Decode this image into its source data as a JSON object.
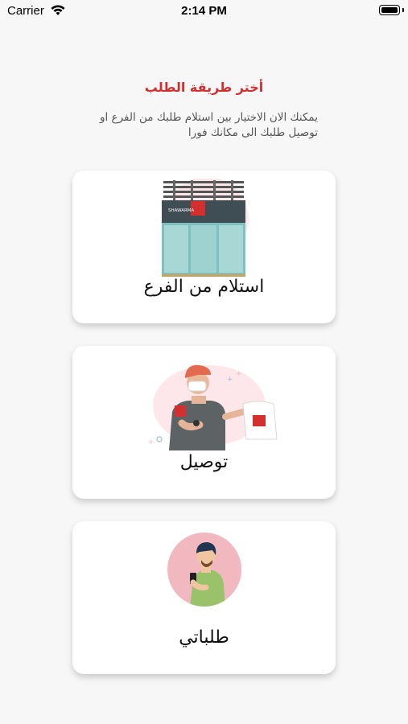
{
  "status_bar": {
    "carrier": "Carrier",
    "time": "2:14 PM"
  },
  "header": {
    "title": "أختر طريقة الطلب",
    "subtitle": "يمكنك الان الاختيار بين استلام طلبك من الفرع او توصيل طلبك الى مكانك فورا"
  },
  "options": [
    {
      "label": "استلام من الفرع",
      "icon": "shop-storefront-icon"
    },
    {
      "label": "توصيل",
      "icon": "delivery-man-icon"
    },
    {
      "label": "طلباتي",
      "icon": "user-orders-icon"
    }
  ],
  "illustration": {
    "store_sign_text": "SHAWARMA"
  },
  "colors": {
    "accent": "#d32f2f",
    "background": "#f7f7f7",
    "card": "#ffffff"
  }
}
